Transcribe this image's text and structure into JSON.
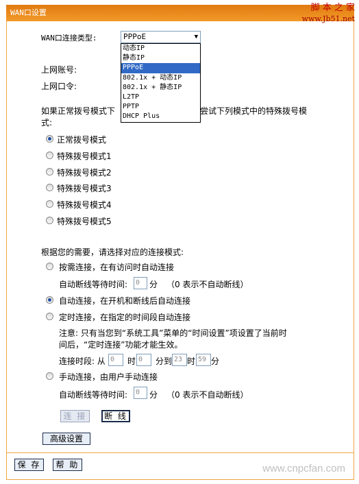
{
  "window": {
    "title": "WAN口设置"
  },
  "watermark": {
    "top_line1": "脚 本 之 家",
    "top_line2": "www.Jb51.net",
    "bottom": "www.cnpcfan.com"
  },
  "connection_type": {
    "label": "WAN口连接类型:",
    "selected": "PPPoE",
    "options": [
      "动态IP",
      "静态IP",
      "PPPoE",
      "802.1x + 动态IP",
      "802.1x + 静态IP",
      "L2TP",
      "PPTP",
      "DHCP Plus"
    ]
  },
  "account": {
    "username_label": "上网账号:",
    "password_label": "上网口令:"
  },
  "dial_mode": {
    "hint_line1a": "如果正常拨号模式下",
    "hint_line1b": "尝试下列模式中的特殊拨号模",
    "hint_line2": "式:",
    "options": [
      "正常拨号模式",
      "特殊拨号模式1",
      "特殊拨号模式2",
      "特殊拨号模式3",
      "特殊拨号模式4",
      "特殊拨号模式5"
    ],
    "selected_index": 0
  },
  "connect_mode": {
    "intro": "根据您的需要，请选择对应的连接模式:",
    "on_demand": "按需连接，在有访问时自动连接",
    "idle_label_1": "自动断线等待时间:",
    "idle_value_1": "0",
    "idle_unit": "分",
    "idle_note": "（0 表示不自动断线）",
    "auto": "自动连接，在开机和断线后自动连接",
    "timed": "定时连接，在指定的时间段自动连接",
    "timed_note_1": "注意: 只有当您到“系统工具”菜单的“时间设置”项设置了当前时",
    "timed_note_2": "间后，“定时连接”功能才能生效。",
    "period_label": "连接时段: 从",
    "from_hour": "0",
    "hour_unit": "时",
    "from_min": "0",
    "to_label": "分到",
    "to_hour": "23",
    "to_min": "59",
    "min_unit": "分",
    "manual": "手动连接，由用户手动连接",
    "idle_label_2": "自动断线等待时间:",
    "idle_value_2": "0",
    "selected": "auto"
  },
  "buttons": {
    "connect": "连 接",
    "disconnect": "断 线",
    "advanced": "高级设置",
    "save": "保 存",
    "help": "帮 助"
  }
}
